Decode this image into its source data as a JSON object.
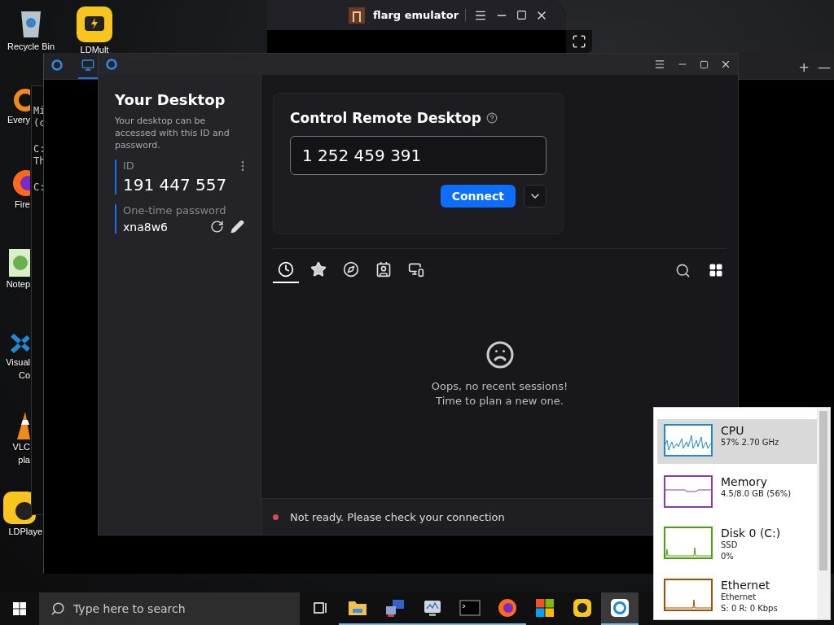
{
  "desktop_icons": [
    {
      "kind": "recycle",
      "lines": [
        "Recycle Bin"
      ]
    },
    {
      "kind": "ldmulti",
      "lines": [
        "LDMult"
      ]
    },
    {
      "kind": "everything",
      "lines": [
        "Every"
      ]
    },
    {
      "kind": "firefox",
      "lines": [
        "Fire"
      ]
    },
    {
      "kind": "notepad",
      "lines": [
        "Notep"
      ]
    },
    {
      "kind": "vscode",
      "lines": [
        "Visual",
        "Co"
      ]
    },
    {
      "kind": "vlc",
      "lines": [
        "VLC",
        "pla"
      ]
    },
    {
      "kind": "ldplayer",
      "lines": [
        "LDPlaye"
      ]
    }
  ],
  "terminal": {
    "lines": [
      "Mi",
      "(c",
      "C:",
      "Th",
      "C:"
    ]
  },
  "emulator": {
    "title": "flarg emulator"
  },
  "back_window": {
    "tabs": [
      {
        "selected": false
      },
      {
        "selected": true
      }
    ],
    "buttons": [
      "+",
      "—"
    ]
  },
  "remote_app": {
    "sidebar": {
      "title": "Your Desktop",
      "description": "Your desktop can be accessed with this ID and password.",
      "id_label": "ID",
      "id_value": "191 447 557",
      "password_label": "One-time password",
      "password_value": "xna8w6"
    },
    "control": {
      "title": "Control Remote Desktop",
      "id_value": "1 252 459 391",
      "connect_button": "Connect"
    },
    "tabs": [
      {
        "kind": "recent",
        "selected": true
      },
      {
        "kind": "favorites",
        "selected": false
      },
      {
        "kind": "discovered",
        "selected": false
      },
      {
        "kind": "address-book",
        "selected": false
      },
      {
        "kind": "devices",
        "selected": false
      }
    ],
    "empty_state": {
      "lines": [
        "Oops, no recent sessions!",
        "Time to plan a new one."
      ]
    },
    "status": {
      "ready": false,
      "text": "Not ready. Please check your connection"
    }
  },
  "performance": {
    "items": [
      {
        "name": "CPU",
        "details": [
          "57%  2.70 GHz"
        ],
        "color": "#1b8ad1",
        "selected": true
      },
      {
        "name": "Memory",
        "details": [
          "4.5/8.0 GB (56%)"
        ],
        "color": "#8b3ba8",
        "selected": false
      },
      {
        "name": "Disk 0 (C:)",
        "details": [
          "SSD",
          "0%"
        ],
        "color": "#4ca20c",
        "selected": false
      },
      {
        "name": "Ethernet",
        "details": [
          "Ethernet",
          "S: 0 R: 0 Kbps"
        ],
        "color": "#a74f01",
        "selected": false
      }
    ]
  },
  "taskbar": {
    "search_placeholder": "Type here to search",
    "apps": [
      {
        "kind": "taskview",
        "running": false,
        "selected": false
      },
      {
        "kind": "explorer",
        "running": true,
        "selected": false
      },
      {
        "kind": "network",
        "running": true,
        "selected": false
      },
      {
        "kind": "monitor",
        "running": true,
        "selected": false
      },
      {
        "kind": "terminal",
        "running": true,
        "selected": false
      },
      {
        "kind": "firefox",
        "running": true,
        "selected": false
      },
      {
        "kind": "store",
        "running": false,
        "selected": false
      },
      {
        "kind": "ldplayer",
        "running": false,
        "selected": false
      },
      {
        "kind": "rustdesk",
        "running": true,
        "selected": true
      }
    ]
  }
}
